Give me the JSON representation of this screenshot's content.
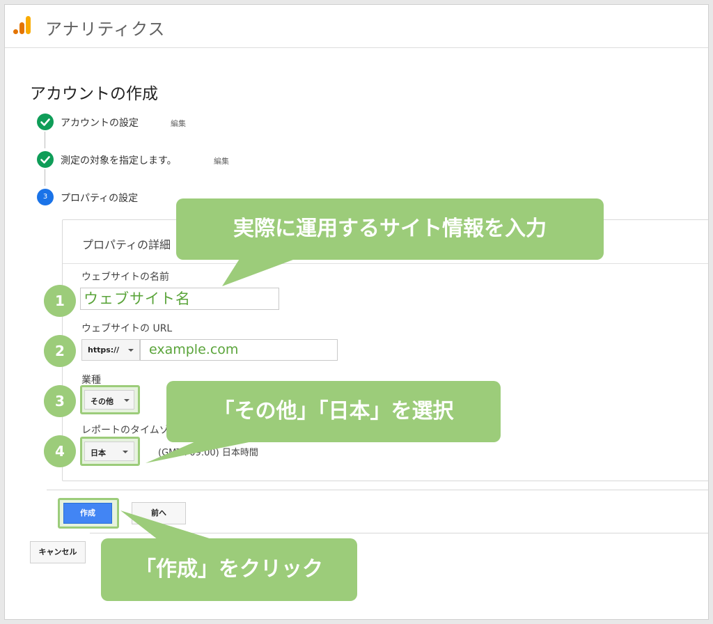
{
  "app": {
    "title": "アナリティクス"
  },
  "page": {
    "title": "アカウントの作成"
  },
  "steps": [
    {
      "label": "アカウントの設定",
      "edit": "編集",
      "state": "done"
    },
    {
      "label": "測定の対象を指定します。",
      "edit": "編集",
      "state": "done"
    },
    {
      "label": "プロパティの設定",
      "number": "3",
      "state": "current"
    }
  ],
  "property": {
    "card_title": "プロパティの詳細",
    "site_name": {
      "label": "ウェブサイトの名前",
      "value": "ウェブサイト名"
    },
    "site_url": {
      "label": "ウェブサイトの URL",
      "protocol": "https://",
      "value": "example.com"
    },
    "industry": {
      "label": "業種",
      "value": "その他"
    },
    "timezone": {
      "label": "レポートのタイムゾーン",
      "country": "日本",
      "zone_text": "(GMT+09:00) 日本時間"
    }
  },
  "badges": [
    "1",
    "2",
    "3",
    "4"
  ],
  "callouts": {
    "enter_info": "実際に運用するサイト情報を入力",
    "select": "「その他」「日本」を選択",
    "click_create": "「作成」をクリック"
  },
  "actions": {
    "create": "作成",
    "back": "前へ",
    "cancel": "キャンセル"
  },
  "colors": {
    "highlight": "#9ccc7a",
    "primary": "#4285f4",
    "done": "#0f9d58",
    "current": "#1a73e8",
    "logo_orange": "#f9ab00",
    "logo_dark": "#e37400"
  }
}
